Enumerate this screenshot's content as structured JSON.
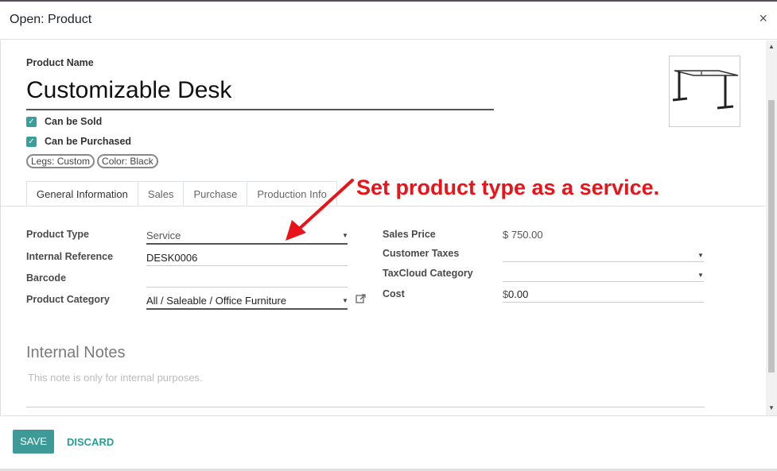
{
  "dialog": {
    "title": "Open: Product",
    "close_label": "×"
  },
  "product": {
    "name_label": "Product Name",
    "name": "Customizable Desk",
    "can_be_sold_label": "Can be Sold",
    "can_be_sold": true,
    "can_be_purchased_label": "Can be Purchased",
    "can_be_purchased": true,
    "tags": [
      "Legs: Custom",
      "Color: Black"
    ]
  },
  "tabs": [
    {
      "label": "General Information",
      "active": true
    },
    {
      "label": "Sales",
      "active": false
    },
    {
      "label": "Purchase",
      "active": false
    },
    {
      "label": "Production Info",
      "active": false
    }
  ],
  "general": {
    "product_type_label": "Product Type",
    "product_type": "Service",
    "internal_reference_label": "Internal Reference",
    "internal_reference": "DESK0006",
    "barcode_label": "Barcode",
    "barcode": "",
    "product_category_label": "Product Category",
    "product_category": "All / Saleable / Office Furniture",
    "sales_price_label": "Sales Price",
    "sales_price": "$ 750.00",
    "customer_taxes_label": "Customer Taxes",
    "customer_taxes": "",
    "taxcloud_category_label": "TaxCloud Category",
    "taxcloud_category": "",
    "cost_label": "Cost",
    "cost_currency": "$",
    "cost": "0.00"
  },
  "notes": {
    "title": "Internal Notes",
    "placeholder": "This note is only for internal purposes."
  },
  "annotation": {
    "text": "Set product type as a service.",
    "color": "#e8141a"
  },
  "footer": {
    "save_label": "SAVE",
    "discard_label": "DISCARD"
  },
  "colors": {
    "accent": "#3d9a96",
    "annotation_red": "#e8141a"
  }
}
